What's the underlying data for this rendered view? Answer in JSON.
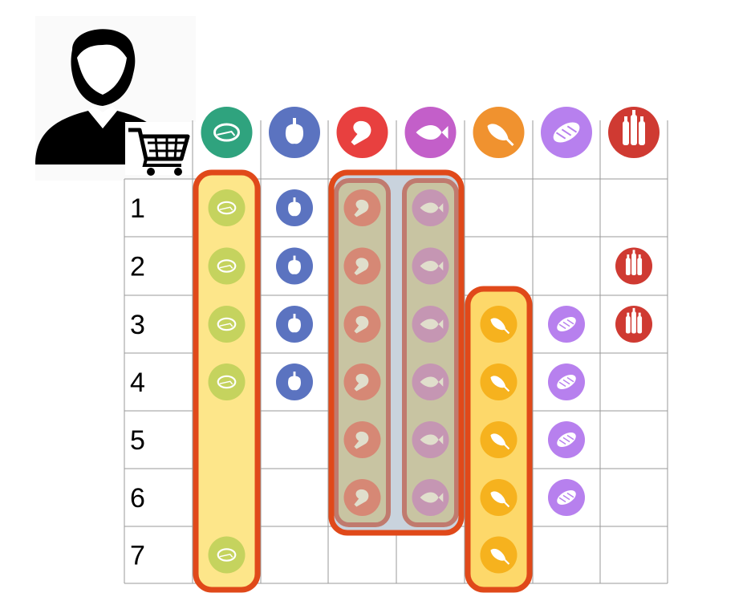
{
  "customer": {
    "icon": "person-icon",
    "cart_icon": "shopping-cart-icon"
  },
  "columns": [
    {
      "key": "meat",
      "icon": "steak-icon",
      "color": "#2fa37e"
    },
    {
      "key": "vegetable",
      "icon": "bell-pepper-icon",
      "color": "#5b73c0"
    },
    {
      "key": "poultry",
      "icon": "chicken-leg-icon",
      "color": "#e8403f"
    },
    {
      "key": "fish",
      "icon": "fish-icon",
      "color": "#c35fc9"
    },
    {
      "key": "ham",
      "icon": "ham-icon",
      "color": "#f0922f"
    },
    {
      "key": "bread",
      "icon": "bread-loaf-icon",
      "color": "#b780ee"
    },
    {
      "key": "drinks",
      "icon": "bottles-icon",
      "color": "#cf3a32"
    }
  ],
  "rows": [
    "1",
    "2",
    "3",
    "4",
    "5",
    "6",
    "7"
  ],
  "cells": {
    "meat": [
      1,
      1,
      1,
      1,
      0,
      0,
      1
    ],
    "vegetable": [
      1,
      1,
      1,
      1,
      0,
      0,
      0
    ],
    "poultry": [
      1,
      1,
      1,
      1,
      1,
      1,
      0
    ],
    "fish": [
      1,
      1,
      1,
      1,
      1,
      1,
      0
    ],
    "ham": [
      0,
      0,
      1,
      1,
      1,
      1,
      1
    ],
    "bread": [
      0,
      0,
      1,
      1,
      1,
      1,
      0
    ],
    "drinks": [
      0,
      1,
      1,
      0,
      0,
      0,
      0
    ]
  },
  "highlights": [
    {
      "name": "meat-group",
      "columns": [
        "meat"
      ],
      "rows": [
        1,
        7
      ],
      "fill": "#fde68a"
    },
    {
      "name": "poultry-fish-group",
      "columns": [
        "poultry",
        "fish"
      ],
      "rows": [
        1,
        6
      ],
      "fill": "#c9d3dd"
    },
    {
      "name": "ham-group",
      "columns": [
        "ham"
      ],
      "rows": [
        3,
        7
      ],
      "fill": "#fdd86a"
    }
  ],
  "colors": {
    "highlight_border": "#e0491a",
    "inner_border": "#c07a6e",
    "grid": "#9a9a9a",
    "icon_cell_bg": "#c5d35e"
  }
}
